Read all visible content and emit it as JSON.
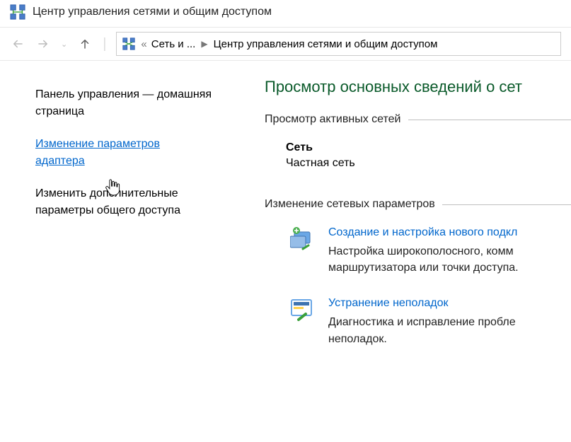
{
  "titlebar": {
    "title": "Центр управления сетями и общим доступом"
  },
  "breadcrumb": {
    "parent": "Сеть и ...",
    "current": "Центр управления сетями и общим доступом"
  },
  "sidebar": {
    "home": "Панель управления — домашняя страница",
    "adapter": "Изменение параметров адаптера",
    "sharing": "Изменить дополнительные параметры общего доступа"
  },
  "main": {
    "heading": "Просмотр основных сведений о сет",
    "active_section": "Просмотр активных сетей",
    "network": {
      "name": "Сеть",
      "type": "Частная сеть"
    },
    "change_section": "Изменение сетевых параметров",
    "options": [
      {
        "link": "Создание и настройка нового подкл",
        "desc": "Настройка широкополосного, комм маршрутизатора или точки доступа."
      },
      {
        "link": "Устранение неполадок",
        "desc": "Диагностика и исправление пробле неполадок."
      }
    ]
  }
}
